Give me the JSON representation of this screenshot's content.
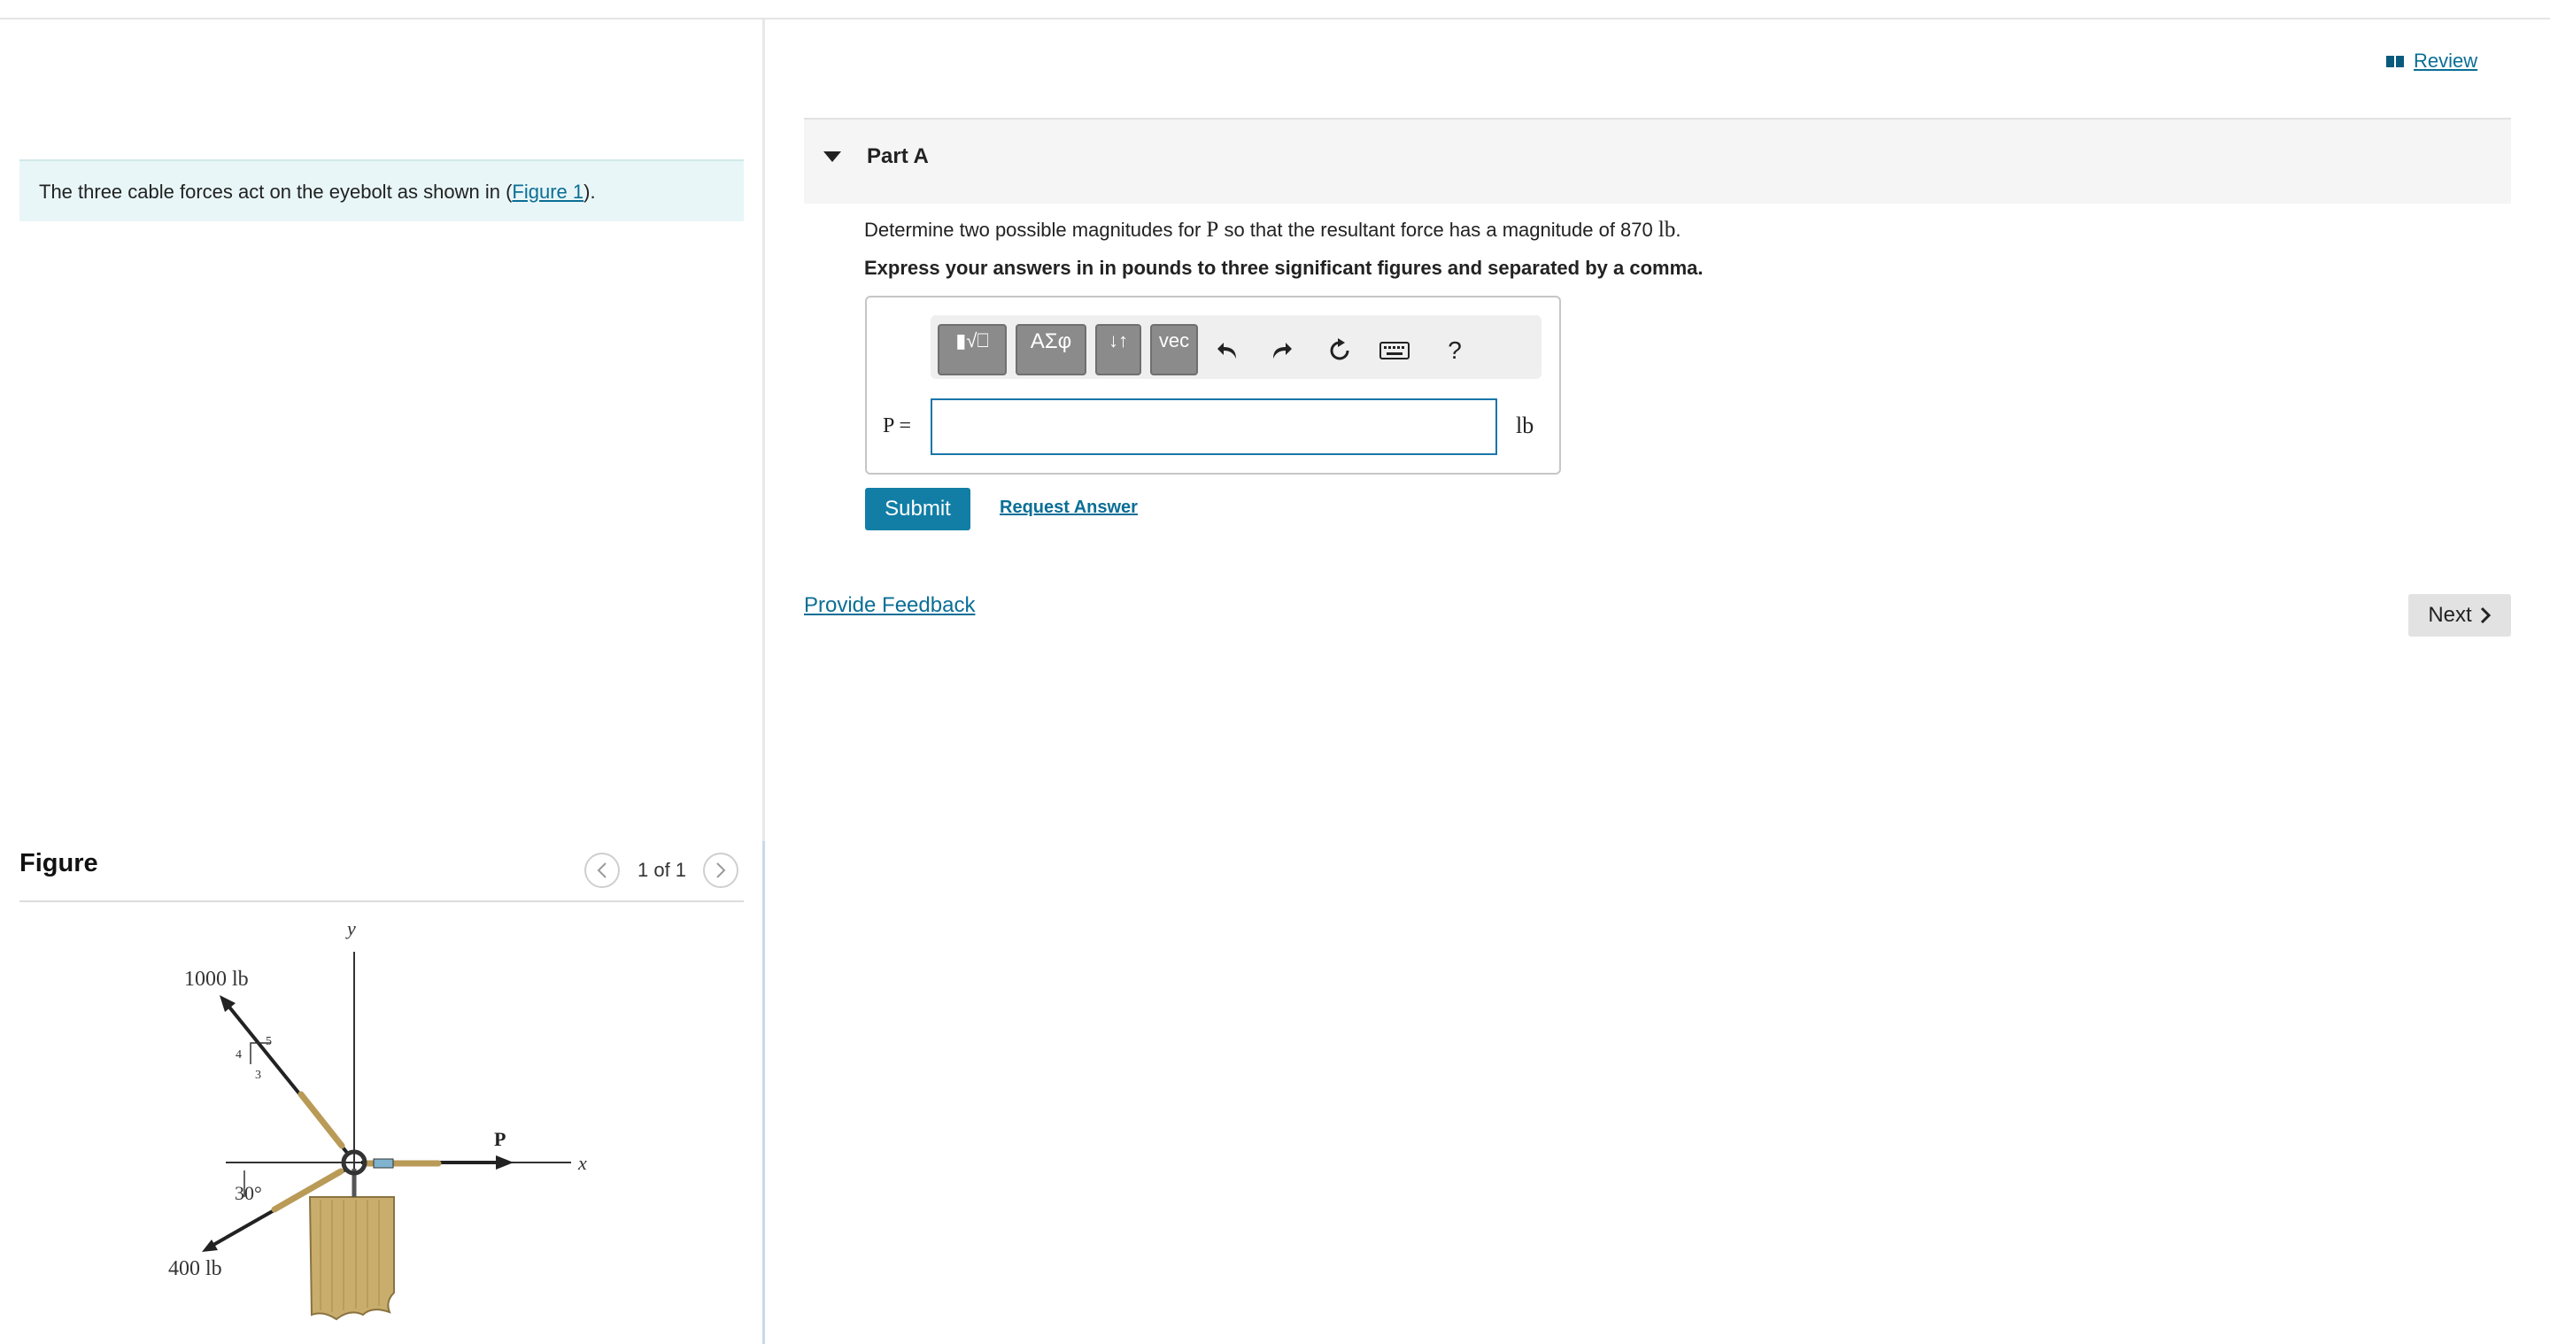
{
  "left": {
    "intro_before": "The three cable forces act on the eyebolt as shown in (",
    "intro_link": "Figure 1",
    "intro_after": ").",
    "figure_title": "Figure",
    "pager_text": "1 of 1",
    "figure": {
      "force_1000": "1000 lb",
      "force_400": "400 lb",
      "force_p": "P",
      "axis_x": "x",
      "axis_y": "y",
      "angle": "30°",
      "slope_5": "5",
      "slope_4": "4",
      "slope_3": "3"
    }
  },
  "right": {
    "review_label": "Review",
    "part_title": "Part A",
    "prompt_before": "Determine two possible magnitudes for ",
    "prompt_var": "P",
    "prompt_middle": " so that the resultant force has a magnitude of 870 ",
    "prompt_unit": "lb",
    "prompt_after": ".",
    "instruction": "Express your answers in in pounds to three significant figures and separated by a comma.",
    "toolbar": {
      "templates": "▮√⎕",
      "greek": "ΑΣφ",
      "arrows": "↓↑",
      "vec": "vec",
      "help": "?"
    },
    "answer_label": "P =",
    "answer_value": "",
    "answer_unit": "lb",
    "submit_label": "Submit",
    "request_label": "Request Answer",
    "feedback_label": "Provide Feedback",
    "next_label": "Next"
  }
}
